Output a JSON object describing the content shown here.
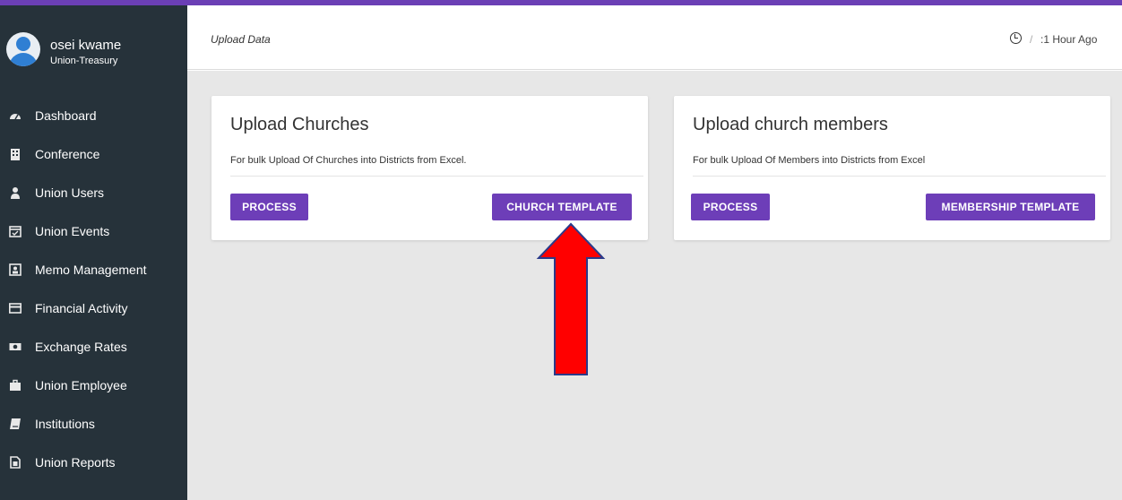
{
  "user": {
    "name": "osei kwame",
    "role": "Union-Treasury"
  },
  "sidebar": {
    "items": [
      {
        "icon": "dashboard-icon",
        "label": "Dashboard"
      },
      {
        "icon": "building-icon",
        "label": "Conference"
      },
      {
        "icon": "user-icon",
        "label": "Union Users"
      },
      {
        "icon": "calendar-check-icon",
        "label": "Union Events"
      },
      {
        "icon": "memo-icon",
        "label": "Memo Management"
      },
      {
        "icon": "credit-card-icon",
        "label": "Financial Activity"
      },
      {
        "icon": "money-bill-icon",
        "label": "Exchange Rates"
      },
      {
        "icon": "briefcase-icon",
        "label": "Union Employee"
      },
      {
        "icon": "book-icon",
        "label": "Institutions"
      },
      {
        "icon": "report-icon",
        "label": "Union Reports"
      }
    ]
  },
  "header": {
    "breadcrumb": "Upload Data",
    "separator": "/",
    "time_ago": ":1 Hour Ago"
  },
  "cards": [
    {
      "title": "Upload Churches",
      "description": "For bulk Upload Of Churches into Districts from Excel.",
      "process_label": "PROCESS",
      "template_label": "CHURCH TEMPLATE"
    },
    {
      "title": "Upload church members",
      "description": "For bulk Upload Of Members into Districts from Excel",
      "process_label": "PROCESS",
      "template_label": "MEMBERSHIP TEMPLATE"
    }
  ],
  "colors": {
    "accent": "#6d3eb8",
    "sidebar_bg": "#26323a",
    "content_bg": "#e7e7e7",
    "annotation_arrow": "#ff0000"
  }
}
